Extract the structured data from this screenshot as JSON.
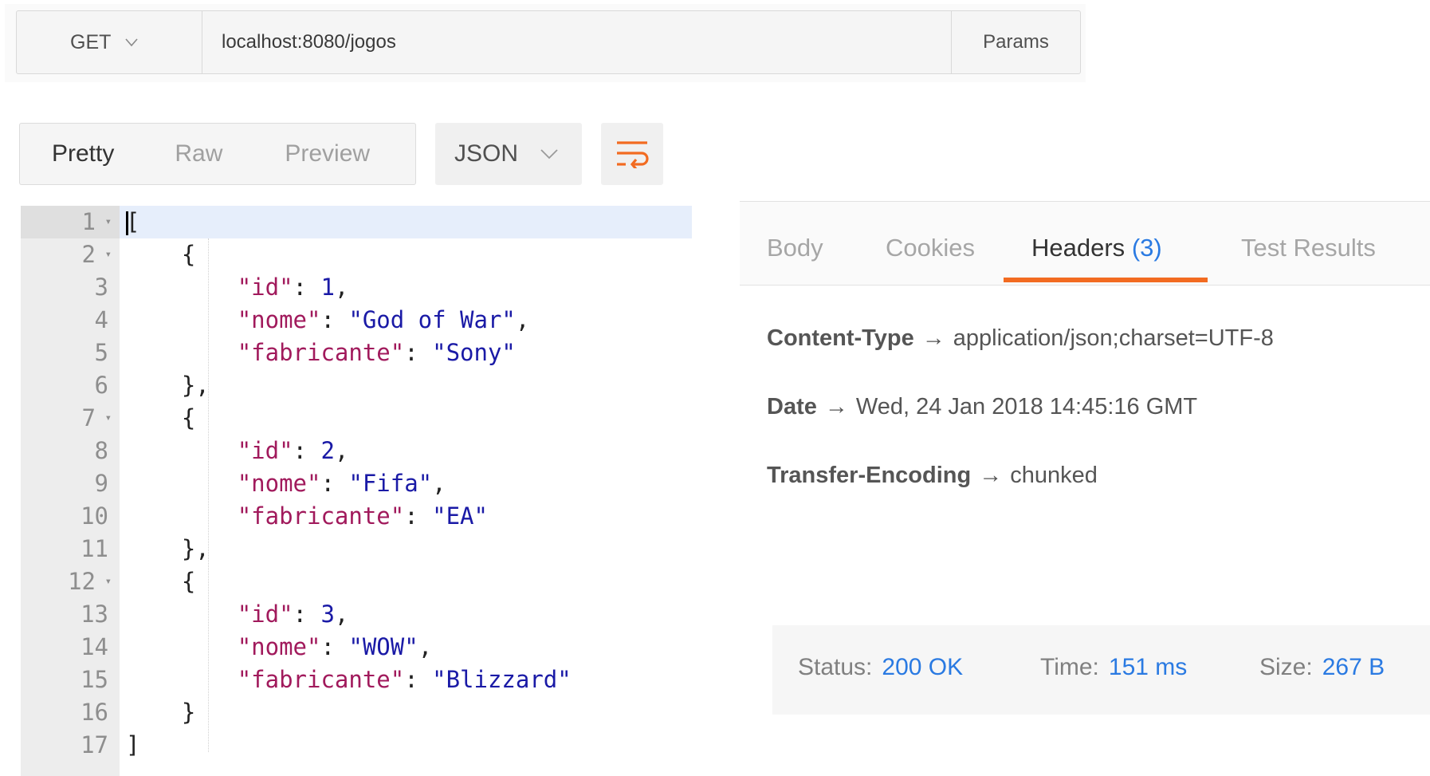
{
  "request": {
    "method": "GET",
    "url": "localhost:8080/jogos",
    "params_label": "Params"
  },
  "view": {
    "tabs": [
      "Pretty",
      "Raw",
      "Preview"
    ],
    "active_tab": "Pretty",
    "format": "JSON"
  },
  "code": {
    "lines": [
      {
        "num": "1",
        "fold": true
      },
      {
        "num": "2",
        "fold": true
      },
      {
        "num": "3",
        "fold": false
      },
      {
        "num": "4",
        "fold": false
      },
      {
        "num": "5",
        "fold": false
      },
      {
        "num": "6",
        "fold": false
      },
      {
        "num": "7",
        "fold": true
      },
      {
        "num": "8",
        "fold": false
      },
      {
        "num": "9",
        "fold": false
      },
      {
        "num": "10",
        "fold": false
      },
      {
        "num": "11",
        "fold": false
      },
      {
        "num": "12",
        "fold": true
      },
      {
        "num": "13",
        "fold": false
      },
      {
        "num": "14",
        "fold": false
      },
      {
        "num": "15",
        "fold": false
      },
      {
        "num": "16",
        "fold": false
      },
      {
        "num": "17",
        "fold": false
      }
    ],
    "records": [
      {
        "id": "1",
        "nome": "\"God of War\"",
        "fabricante": "\"Sony\""
      },
      {
        "id": "2",
        "nome": "\"Fifa\"",
        "fabricante": "\"EA\""
      },
      {
        "id": "3",
        "nome": "\"WOW\"",
        "fabricante": "\"Blizzard\""
      }
    ],
    "keys": {
      "id": "\"id\"",
      "nome": "\"nome\"",
      "fabricante": "\"fabricante\""
    }
  },
  "response": {
    "tabs": {
      "body": "Body",
      "cookies": "Cookies",
      "headers": "Headers",
      "headers_count": "(3)",
      "tests": "Test Results"
    },
    "active_tab": "Headers",
    "headers": [
      {
        "key": "Content-Type",
        "value": "application/json;charset=UTF-8"
      },
      {
        "key": "Date",
        "value": "Wed, 24 Jan 2018 14:45:16 GMT"
      },
      {
        "key": "Transfer-Encoding",
        "value": "chunked"
      }
    ],
    "arrow": "→",
    "status": {
      "status_label": "Status:",
      "status_value": "200 OK",
      "time_label": "Time:",
      "time_value": "151 ms",
      "size_label": "Size:",
      "size_value": "267 B"
    }
  },
  "colors": {
    "accent": "#f26b21",
    "link": "#2a7ae2",
    "json_key": "#a11a5c",
    "json_value": "#1a1aa6"
  },
  "icons": {
    "method_dropdown": "chevron-down-icon",
    "format_dropdown": "chevron-down-icon",
    "wrap": "wrap-lines-icon",
    "fold": "fold-triangle-icon"
  }
}
